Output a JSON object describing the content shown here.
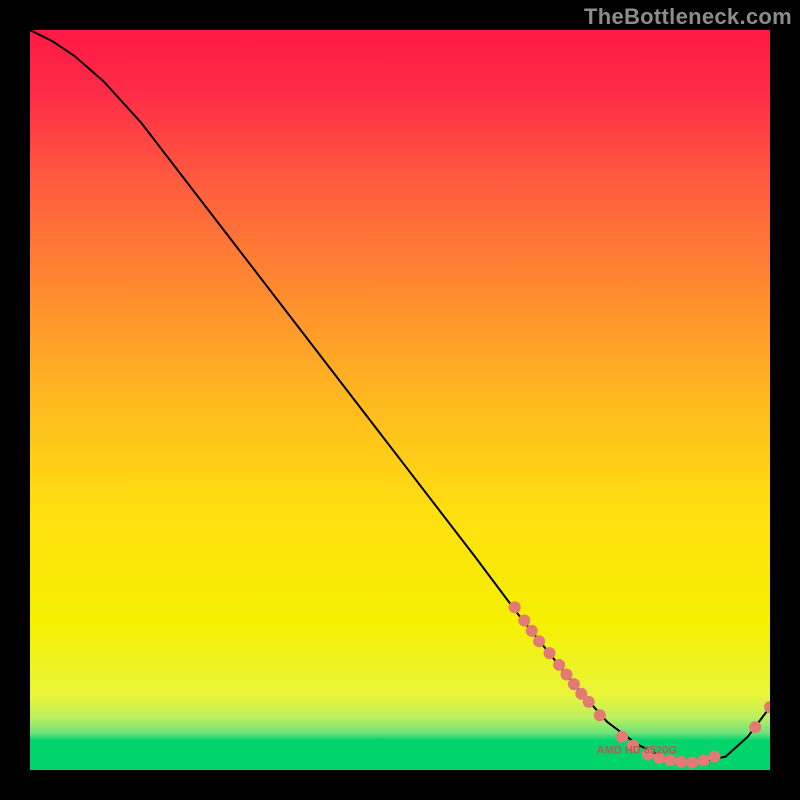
{
  "chart_data": {
    "type": "line",
    "watermark": "TheBottleneck.com",
    "xlim": [
      0,
      100
    ],
    "ylim": [
      0,
      100
    ],
    "xlabel": "",
    "ylabel": "",
    "title": "",
    "legend": false,
    "grid": false,
    "background_gradient": {
      "top_color": "#ff1a44",
      "mid_color": "#ffe100",
      "bottom_band_color": "#00d46a",
      "bottom_band_fraction": 0.04
    },
    "curve": {
      "x": [
        0,
        3,
        6,
        10,
        15,
        20,
        30,
        40,
        50,
        60,
        66,
        70,
        74,
        78,
        82,
        86,
        90,
        94,
        97,
        100
      ],
      "y": [
        100,
        98.5,
        96.5,
        93,
        87.5,
        81,
        68,
        55,
        42,
        29,
        21,
        16,
        11,
        6.5,
        3.5,
        1.5,
        1.0,
        1.8,
        4.5,
        8.5
      ],
      "stroke": "#000000",
      "stroke_width": 2
    },
    "marker_cluster": {
      "note": "visual dot cluster along the lower section of the curve",
      "color": "#e17b74",
      "radius": 6,
      "points": [
        {
          "x": 65.5,
          "y": 22.0
        },
        {
          "x": 66.8,
          "y": 20.2
        },
        {
          "x": 67.8,
          "y": 18.8
        },
        {
          "x": 68.8,
          "y": 17.4
        },
        {
          "x": 70.2,
          "y": 15.8
        },
        {
          "x": 71.5,
          "y": 14.2
        },
        {
          "x": 72.5,
          "y": 12.9
        },
        {
          "x": 73.5,
          "y": 11.6
        },
        {
          "x": 74.5,
          "y": 10.3
        },
        {
          "x": 75.5,
          "y": 9.2
        },
        {
          "x": 77.0,
          "y": 7.4
        },
        {
          "x": 80.0,
          "y": 4.5
        },
        {
          "x": 81.5,
          "y": 3.3
        },
        {
          "x": 83.5,
          "y": 2.1
        },
        {
          "x": 85.0,
          "y": 1.6
        },
        {
          "x": 86.5,
          "y": 1.3
        },
        {
          "x": 88.0,
          "y": 1.1
        },
        {
          "x": 89.5,
          "y": 1.0
        },
        {
          "x": 91.0,
          "y": 1.3
        },
        {
          "x": 92.5,
          "y": 1.8
        },
        {
          "x": 98.0,
          "y": 5.8
        },
        {
          "x": 100.0,
          "y": 8.5
        }
      ]
    },
    "inline_label": {
      "text": "AMD HD 6520G",
      "x": 82,
      "y": 2.2,
      "color": "#b85a54",
      "font_size_px": 11
    }
  }
}
